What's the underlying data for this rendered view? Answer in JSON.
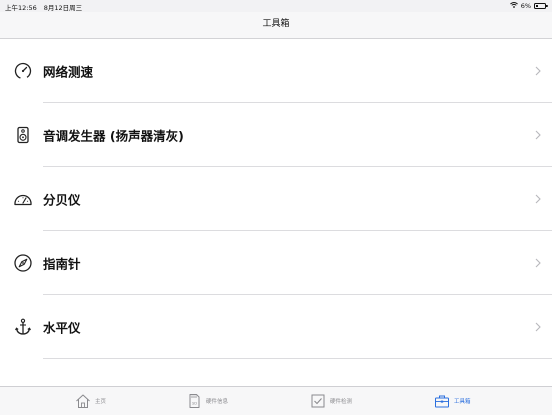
{
  "status_bar": {
    "time": "上午12:56",
    "date": "8月12日周三",
    "battery": "6%"
  },
  "nav": {
    "title": "工具箱"
  },
  "tools": [
    {
      "label": "网络测速",
      "icon": "speedometer-icon"
    },
    {
      "label": "音调发生器 (扬声器清灰)",
      "icon": "speaker-icon"
    },
    {
      "label": "分贝仪",
      "icon": "decibel-meter-icon"
    },
    {
      "label": "指南针",
      "icon": "compass-icon"
    },
    {
      "label": "水平仪",
      "icon": "anchor-icon"
    }
  ],
  "tabs": [
    {
      "label": "主页",
      "icon": "home-icon",
      "active": false
    },
    {
      "label": "硬件信息",
      "icon": "sd-card-icon",
      "active": false
    },
    {
      "label": "硬件检测",
      "icon": "checkbox-icon",
      "active": false
    },
    {
      "label": "工具箱",
      "icon": "toolbox-icon",
      "active": true
    }
  ],
  "colors": {
    "accent": "#2b6fde",
    "inactive": "#8a8a8e",
    "background": "#f2f2f4",
    "list_background": "#ffffff"
  }
}
